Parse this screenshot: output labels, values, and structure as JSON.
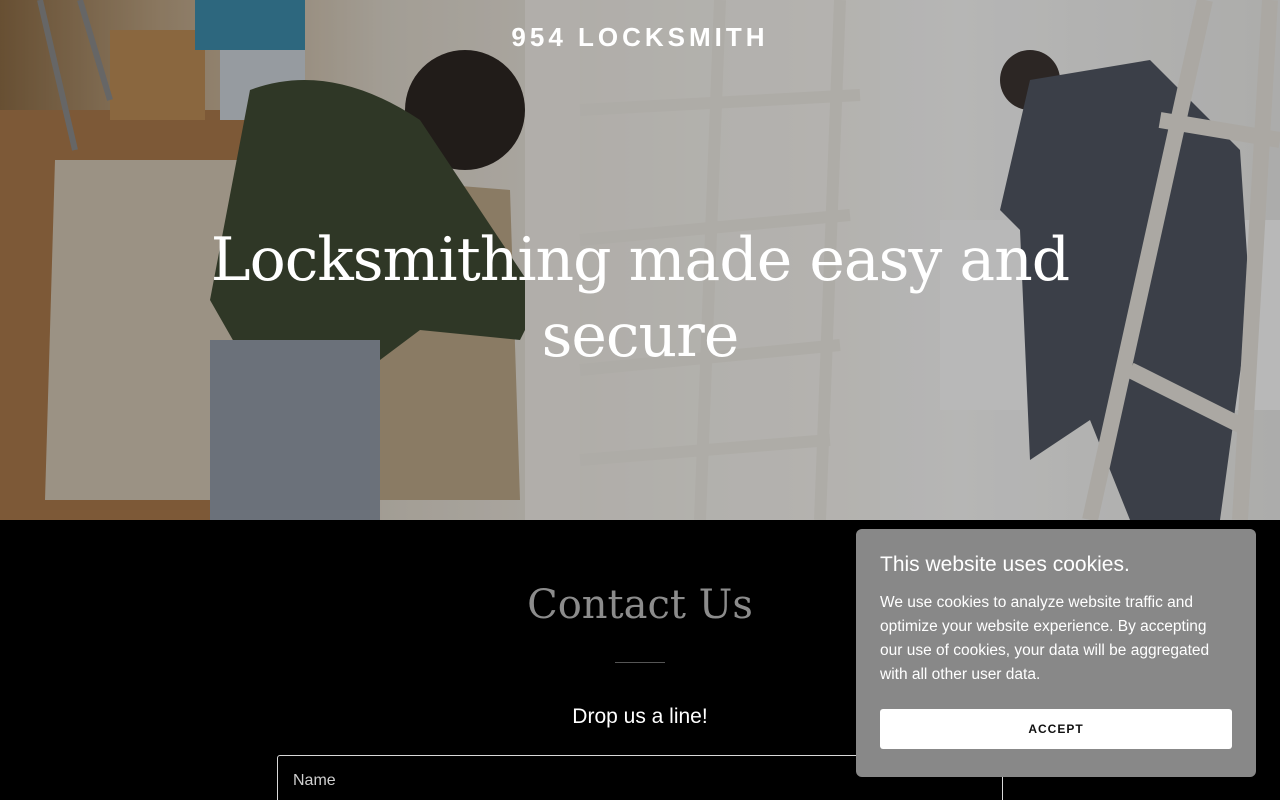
{
  "header": {
    "site_title": "954 LOCKSMITH"
  },
  "hero": {
    "heading": "Locksmithing made easy and secure"
  },
  "contact": {
    "title": "Contact Us",
    "subtitle": "Drop us a line!",
    "name_placeholder": "Name"
  },
  "cookie_banner": {
    "title": "This website uses cookies.",
    "text": "We use cookies to analyze website traffic and optimize your website experience. By accepting our use of cookies, your data will be aggregated with all other user data.",
    "accept_label": "ACCEPT"
  },
  "colors": {
    "background": "#000000",
    "cookie_banner": "#888888",
    "accept_button": "#ffffff",
    "contact_title": "#8c8c8c"
  }
}
